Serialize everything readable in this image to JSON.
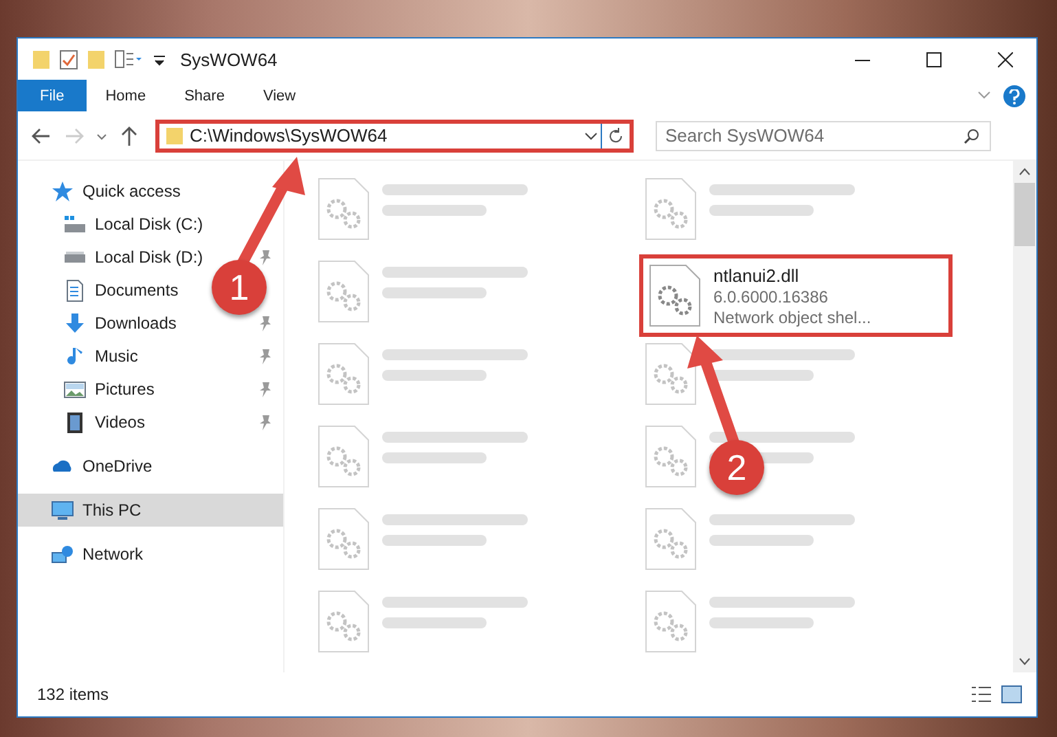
{
  "window": {
    "title": "SysWOW64"
  },
  "ribbon_tabs": [
    {
      "label": "File",
      "selected": true
    },
    {
      "label": "Home",
      "selected": false
    },
    {
      "label": "Share",
      "selected": false
    },
    {
      "label": "View",
      "selected": false
    }
  ],
  "address_bar": {
    "path": "C:\\Windows\\SysWOW64",
    "highlighted": true
  },
  "search": {
    "placeholder": "Search SysWOW64"
  },
  "sidebar": {
    "items": [
      {
        "label": "Quick access",
        "kind": "star",
        "selected": false,
        "children": [
          {
            "label": "Local Disk (C:)",
            "kind": "drive-win",
            "pinned": false,
            "selected": false
          },
          {
            "label": "Local Disk (D:)",
            "kind": "drive",
            "pinned": true,
            "selected": false
          },
          {
            "label": "Documents",
            "kind": "documents",
            "pinned": false,
            "selected": false
          },
          {
            "label": "Downloads",
            "kind": "downloads",
            "pinned": true,
            "selected": false
          },
          {
            "label": "Music",
            "kind": "music",
            "pinned": true,
            "selected": false
          },
          {
            "label": "Pictures",
            "kind": "pictures",
            "pinned": true,
            "selected": false
          },
          {
            "label": "Videos",
            "kind": "videos",
            "pinned": true,
            "selected": false
          }
        ]
      },
      {
        "label": "OneDrive",
        "kind": "cloud",
        "selected": false
      },
      {
        "label": "This PC",
        "kind": "pc",
        "selected": true
      },
      {
        "label": "Network",
        "kind": "network",
        "selected": false
      }
    ]
  },
  "files": [
    {
      "kind": "blurred"
    },
    {
      "kind": "blurred"
    },
    {
      "kind": "blurred"
    },
    {
      "kind": "file",
      "name": "ntlanui2.dll",
      "details": [
        "6.0.6000.16386",
        "Network object shel..."
      ],
      "highlighted": true
    },
    {
      "kind": "blurred"
    },
    {
      "kind": "blurred"
    },
    {
      "kind": "blurred"
    },
    {
      "kind": "blurred"
    },
    {
      "kind": "blurred"
    },
    {
      "kind": "blurred"
    },
    {
      "kind": "blurred"
    },
    {
      "kind": "blurred"
    }
  ],
  "status_bar": {
    "item_count": "132 items"
  },
  "annotations": [
    {
      "label": "1"
    },
    {
      "label": "2"
    }
  ]
}
